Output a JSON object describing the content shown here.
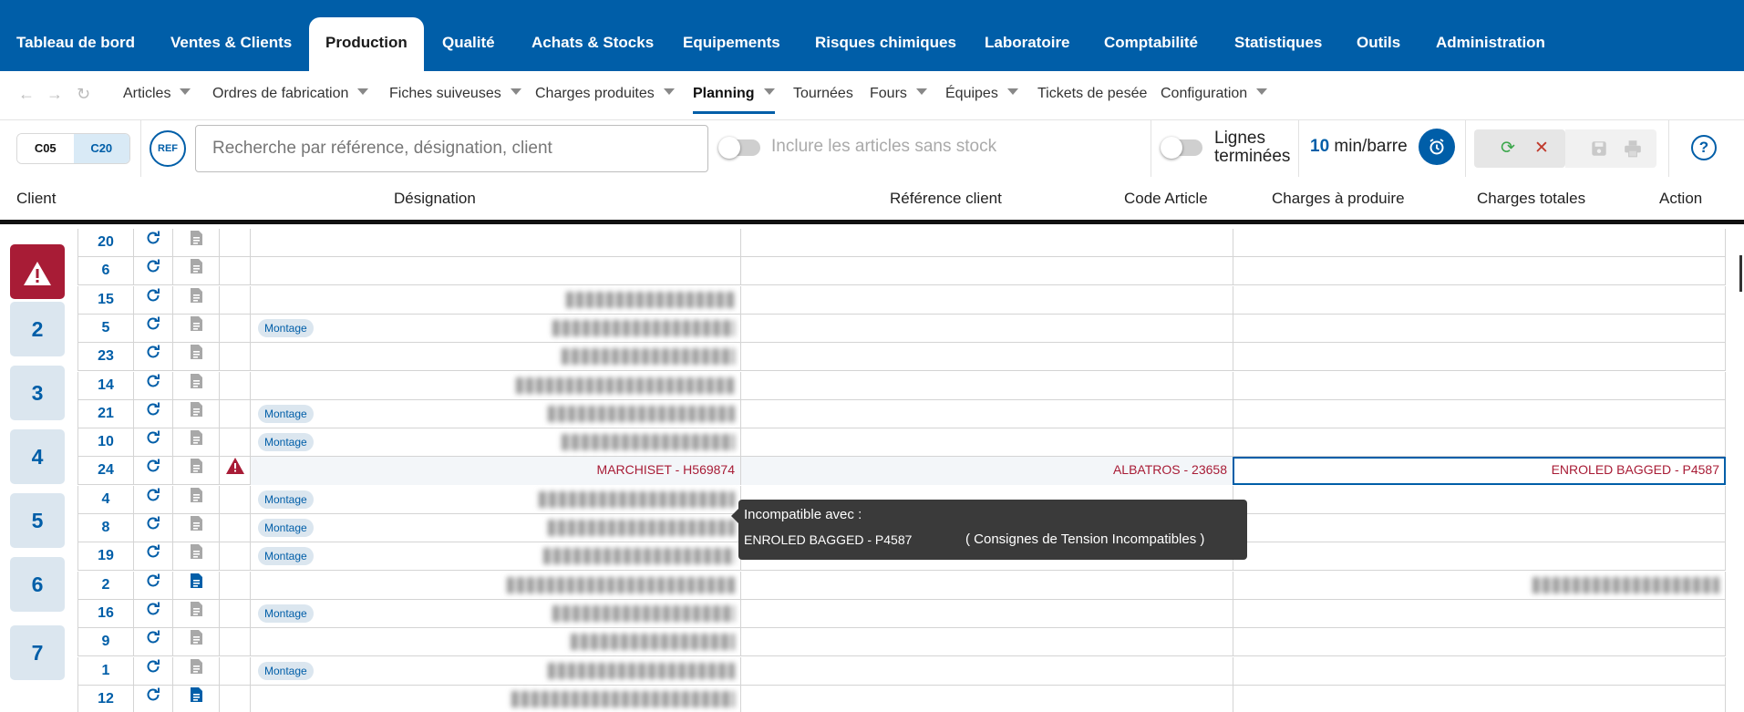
{
  "topnav": {
    "tabs": [
      {
        "label": "Tableau de bord"
      },
      {
        "label": "Ventes & Clients"
      },
      {
        "label": "Production"
      },
      {
        "label": "Qualité"
      },
      {
        "label": "Achats & Stocks"
      },
      {
        "label": "Equipements"
      },
      {
        "label": "Risques chimiques"
      },
      {
        "label": "Laboratoire"
      },
      {
        "label": "Comptabilité"
      },
      {
        "label": "Statistiques"
      },
      {
        "label": "Outils"
      },
      {
        "label": "Administration"
      }
    ],
    "active": "Production"
  },
  "subnav": {
    "items": [
      {
        "label": "Articles"
      },
      {
        "label": "Ordres de fabrication"
      },
      {
        "label": "Fiches suiveuses"
      },
      {
        "label": "Charges produites"
      },
      {
        "label": "Planning"
      },
      {
        "label": "Tournées"
      },
      {
        "label": "Fours"
      },
      {
        "label": "Équipes"
      },
      {
        "label": "Tickets de pesée"
      },
      {
        "label": "Configuration"
      }
    ],
    "active": "Planning"
  },
  "toolbar": {
    "seg1": "C05",
    "seg2": "C20",
    "ref_button": "REF",
    "search_placeholder": "Recherche par référence, désignation, client",
    "include_label": "Inclure les articles sans stock",
    "lignes_label_1": "Lignes",
    "lignes_label_2": "terminées",
    "min_value": "10",
    "min_unit": "min/barre",
    "help": "?"
  },
  "columns": {
    "client": "Client",
    "designation": "Désignation",
    "reference_client": "Référence client",
    "code_article": "Code Article",
    "charges_a_produire": "Charges à produire",
    "charges_totales": "Charges totales",
    "action": "Action"
  },
  "sidebar": {
    "buttons": [
      "2",
      "3",
      "4",
      "5",
      "6",
      "7"
    ]
  },
  "rows": [
    {
      "num": "20",
      "tag": "",
      "c1": "",
      "c2": "",
      "c3": ""
    },
    {
      "num": "6",
      "tag": "",
      "c1": "",
      "c2": "",
      "c3": ""
    },
    {
      "num": "15",
      "tag": "",
      "c1": "",
      "c2": "",
      "c3": ""
    },
    {
      "num": "5",
      "tag": "Montage",
      "c1": "",
      "c2": "",
      "c3": ""
    },
    {
      "num": "23",
      "tag": "",
      "c1": "",
      "c2": "",
      "c3": ""
    },
    {
      "num": "14",
      "tag": "",
      "c1": "",
      "c2": "",
      "c3": ""
    },
    {
      "num": "21",
      "tag": "Montage",
      "c1": "",
      "c2": "",
      "c3": ""
    },
    {
      "num": "10",
      "tag": "Montage",
      "c1": "",
      "c2": "",
      "c3": ""
    },
    {
      "num": "24",
      "tag": "",
      "c1": "MARCHISET - H569874",
      "c2": "ALBATROS - 23658",
      "c3": "ENROLED BAGGED - P4587"
    },
    {
      "num": "4",
      "tag": "Montage",
      "c1": "",
      "c2": "",
      "c3": ""
    },
    {
      "num": "8",
      "tag": "Montage",
      "c1": "",
      "c2": "",
      "c3": ""
    },
    {
      "num": "19",
      "tag": "Montage",
      "c1": "",
      "c2": "",
      "c3": ""
    },
    {
      "num": "2",
      "tag": "",
      "c1": "",
      "c2": "",
      "c3": ""
    },
    {
      "num": "16",
      "tag": "Montage",
      "c1": "",
      "c2": "",
      "c3": ""
    },
    {
      "num": "9",
      "tag": "",
      "c1": "",
      "c2": "",
      "c3": ""
    },
    {
      "num": "1",
      "tag": "Montage",
      "c1": "",
      "c2": "",
      "c3": ""
    },
    {
      "num": "12",
      "tag": "",
      "c1": "",
      "c2": "",
      "c3": ""
    }
  ],
  "tooltip": {
    "title": "Incompatible avec :",
    "item": "ENROLED BAGGED - P4587",
    "reason": "( Consignes de Tension Incompatibles )"
  },
  "colors": {
    "brand": "#005ea8",
    "warning": "#a81c36",
    "tag_bg": "#dbe6ef"
  },
  "icons": [
    "refresh-icon",
    "document-icon",
    "warning-icon",
    "alarm-clock-icon",
    "sync-icon",
    "close-icon",
    "save-icon",
    "print-icon",
    "help-icon"
  ]
}
